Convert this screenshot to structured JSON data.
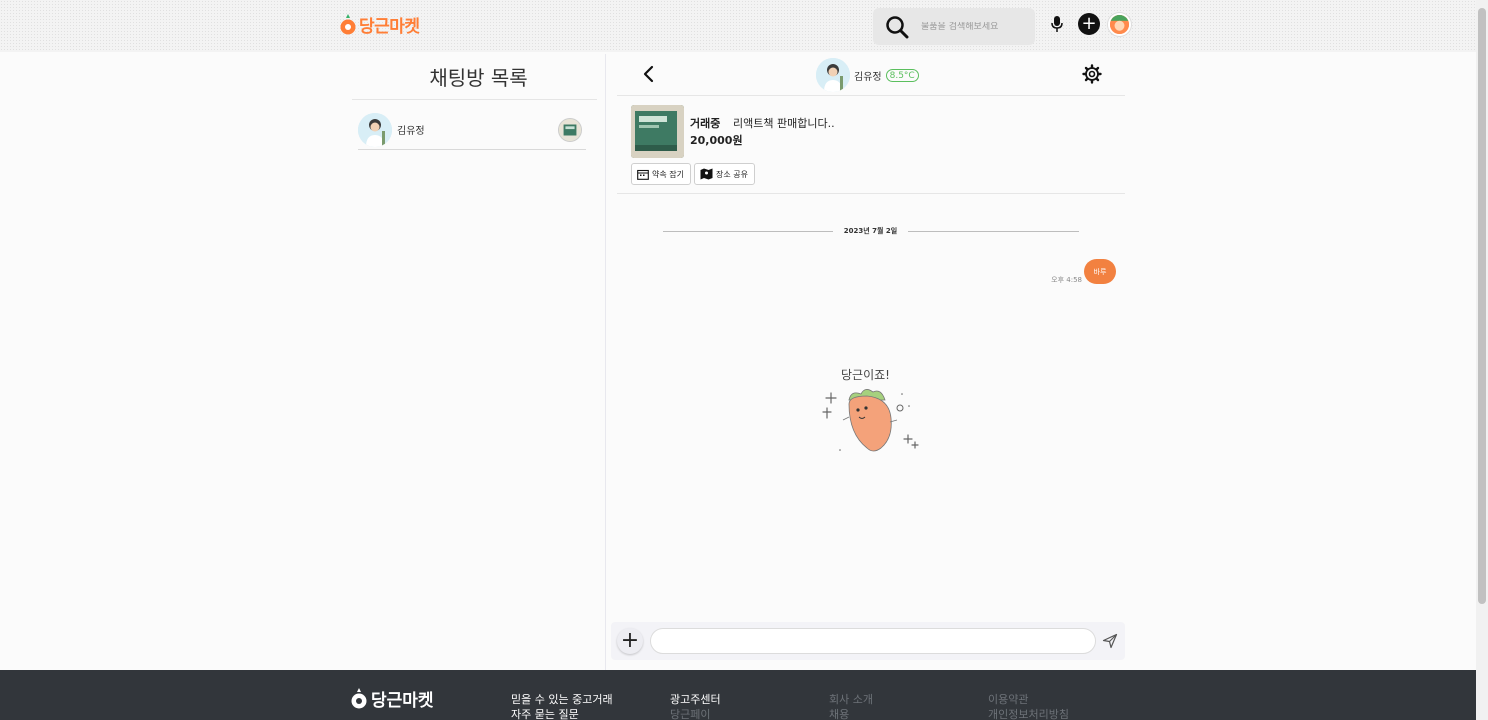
{
  "header": {
    "logo_text": "당근마켓",
    "search_placeholder": "물품을 검색해보세요"
  },
  "left_panel": {
    "title": "채팅방 목록",
    "rooms": [
      {
        "name": "김유정"
      }
    ]
  },
  "chat": {
    "user_name": "김유정",
    "manner_temp": "8.5°C",
    "product": {
      "status": "거래중",
      "title": "리액트책 판매합니다..",
      "price": "20,000원"
    },
    "buttons": {
      "appointment": "약속 잡기",
      "share_place": "장소 공유"
    },
    "date_separator": "2023년 7월 2일",
    "messages": [
      {
        "time": "오후 4:58",
        "text": "바루"
      }
    ],
    "sticker_text": "당근이죠!",
    "input_value": ""
  },
  "footer": {
    "logo_text": "당근마켓",
    "columns": [
      [
        "믿을 수 있는 중고거래",
        "자주 묻는 질문"
      ],
      [
        "광고주센터",
        "당근페이"
      ],
      [
        "회사 소개",
        "채용"
      ],
      [
        "이용약관",
        "개인정보처리방침"
      ]
    ]
  },
  "colors": {
    "brand": "#ff7e36",
    "bubble": "#f28140",
    "manner": "#5bbf5e",
    "footer_bg": "#32363b"
  }
}
